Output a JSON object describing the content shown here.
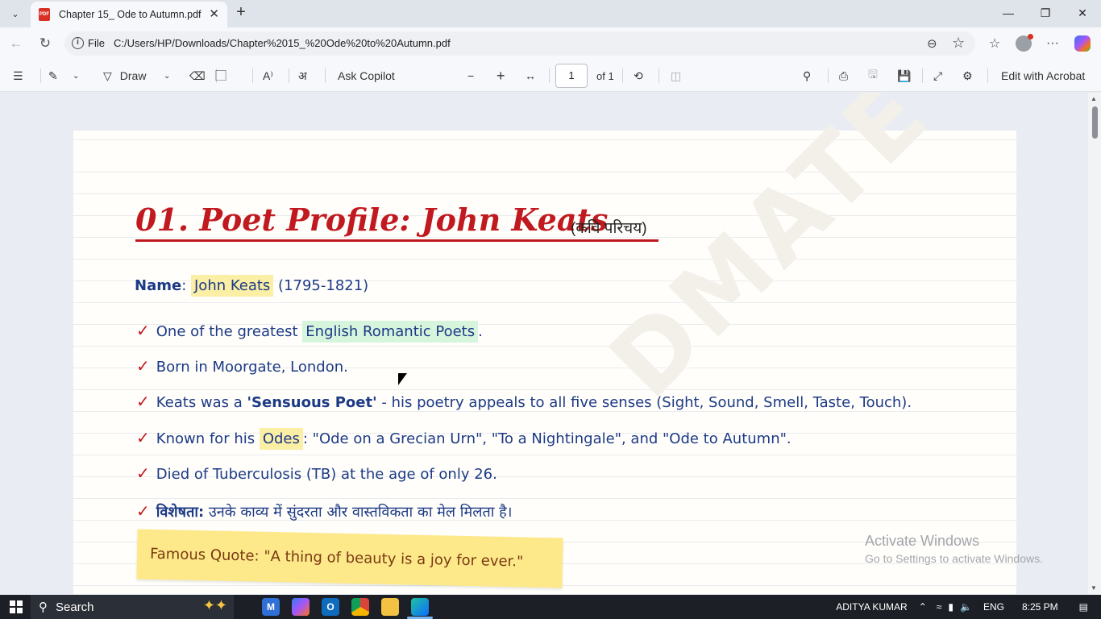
{
  "browser": {
    "tab_title": "Chapter 15_ Ode to Autumn.pdf",
    "tab_icon": "PDF",
    "address_scheme": "File",
    "address_url": "C:/Users/HP/Downloads/Chapter%2015_%20Ode%20to%20Autumn.pdf"
  },
  "toolbar": {
    "draw_label": "Draw",
    "ask_copilot_label": "Ask Copilot",
    "page_current": "1",
    "page_total_label": "of 1",
    "edit_acrobat_label": "Edit with Acrobat"
  },
  "document": {
    "heading": "01. Poet Profile: John Keats",
    "heading_hindi": "(कवि परिचय)",
    "name_label": "Name",
    "name_colon": ":",
    "name_value": "John Keats",
    "name_years": "(1795-1821)",
    "bullets": [
      {
        "pre": "One of the greatest ",
        "highlight": "English Romantic Poets",
        "post": "."
      },
      {
        "text": "Born in Moorgate, London."
      },
      {
        "pre": "Keats was a ",
        "bold": "'Sensuous Poet'",
        "post": " - his poetry appeals to all five senses (Sight, Sound, Smell, Taste, Touch)."
      },
      {
        "pre": "Known for his ",
        "highlight": "Odes",
        "post": ": \"Ode on a Grecian Urn\", \"To a Nightingale\", and \"Ode to Autumn\"."
      },
      {
        "text": "Died of Tuberculosis (TB) at the age of only 26."
      },
      {
        "bold": "विशेषता:",
        "post": " उनके काव्य में सुंदरता और वास्तविकता का मेल मिलता है।"
      }
    ],
    "check_mark": "✓",
    "quote": "Famous Quote: \"A thing of beauty is a joy for ever.\"",
    "watermark": "DMATE"
  },
  "overlay": {
    "activate_title": "Activate Windows",
    "activate_sub": "Go to Settings to activate Windows."
  },
  "taskbar": {
    "search_placeholder": "Search",
    "user": "ADITYA KUMAR",
    "lang": "ENG",
    "time": "8:25 PM"
  },
  "colors": {
    "heading_red": "#c0191f",
    "ink_blue": "#1c3a86",
    "highlight_yellow": "#fbeea5",
    "highlight_green": "#d6f5dc",
    "sticky_note": "#fde98a"
  }
}
